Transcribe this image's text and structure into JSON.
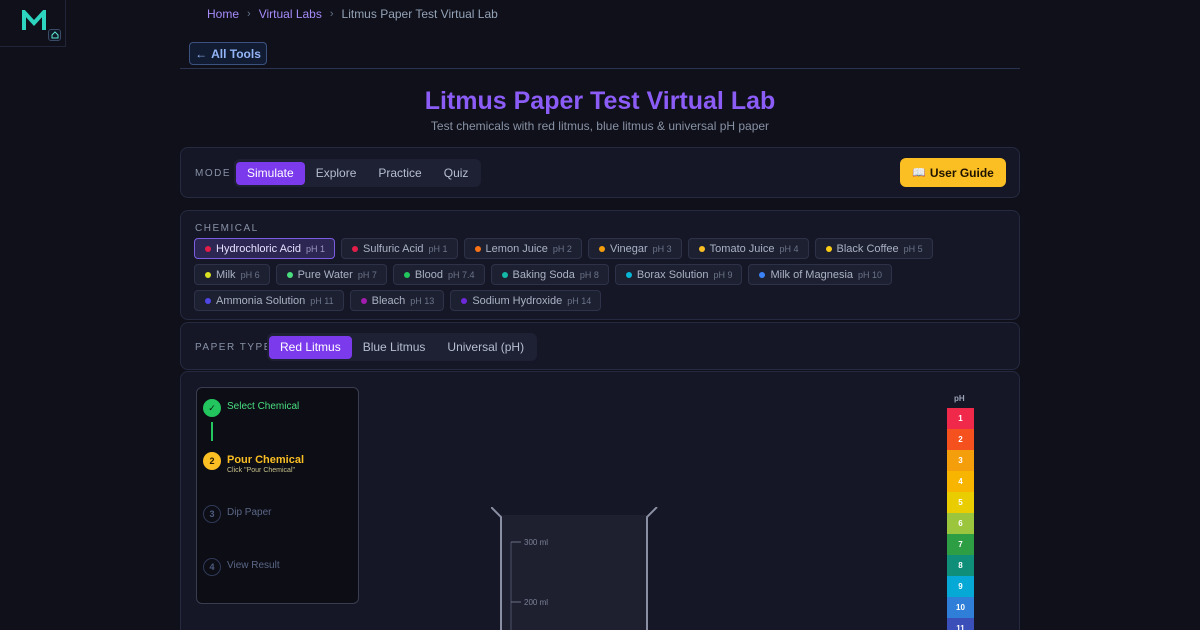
{
  "logo": {
    "letter": "M",
    "icon": "home-icon"
  },
  "breadcrumb": {
    "items": [
      "Home",
      "Virtual Labs"
    ],
    "current": "Litmus Paper Test Virtual Lab",
    "separator": "›"
  },
  "back_button": {
    "label": "All Tools",
    "icon": "arrow-left-icon"
  },
  "header": {
    "title": "Litmus Paper Test Virtual Lab",
    "subtitle": "Test chemicals with red litmus, blue litmus & universal pH paper"
  },
  "mode": {
    "label": "MODE",
    "options": [
      "Simulate",
      "Explore",
      "Practice",
      "Quiz"
    ],
    "selected": "Simulate"
  },
  "user_guide": {
    "label": "User Guide",
    "icon": "📖"
  },
  "chemical": {
    "label": "CHEMICAL",
    "selected": "Hydrochloric Acid",
    "items": [
      {
        "name": "Hydrochloric Acid",
        "ph": "pH 1",
        "color": "#e11d48"
      },
      {
        "name": "Sulfuric Acid",
        "ph": "pH 1",
        "color": "#e11d48"
      },
      {
        "name": "Lemon Juice",
        "ph": "pH 2",
        "color": "#f97316"
      },
      {
        "name": "Vinegar",
        "ph": "pH 3",
        "color": "#f59e0b"
      },
      {
        "name": "Tomato Juice",
        "ph": "pH 4",
        "color": "#fbbf24"
      },
      {
        "name": "Black Coffee",
        "ph": "pH 5",
        "color": "#facc15"
      },
      {
        "name": "Milk",
        "ph": "pH 6",
        "color": "#d9e021"
      },
      {
        "name": "Pure Water",
        "ph": "pH 7",
        "color": "#4ade80"
      },
      {
        "name": "Blood",
        "ph": "pH 7.4",
        "color": "#22c55e"
      },
      {
        "name": "Baking Soda",
        "ph": "pH 8",
        "color": "#14b8a6"
      },
      {
        "name": "Borax Solution",
        "ph": "pH 9",
        "color": "#06b6d4"
      },
      {
        "name": "Milk of Magnesia",
        "ph": "pH 10",
        "color": "#3b82f6"
      },
      {
        "name": "Ammonia Solution",
        "ph": "pH 11",
        "color": "#4f46e5"
      },
      {
        "name": "Bleach",
        "ph": "pH 13",
        "color": "#a21caf"
      },
      {
        "name": "Sodium Hydroxide",
        "ph": "pH 14",
        "color": "#6d28d9"
      }
    ]
  },
  "paper_type": {
    "label": "PAPER TYPE",
    "options": [
      "Red Litmus",
      "Blue Litmus",
      "Universal (pH)"
    ],
    "selected": "Red Litmus"
  },
  "steps": [
    {
      "num": "1",
      "label": "Select Chemical",
      "state": "done",
      "icon": "check-icon"
    },
    {
      "num": "2",
      "label": "Pour Chemical",
      "hint": "Click \"Pour Chemical\"",
      "state": "current"
    },
    {
      "num": "3",
      "label": "Dip Paper",
      "state": "todo"
    },
    {
      "num": "4",
      "label": "View Result",
      "state": "todo"
    }
  ],
  "beaker": {
    "marks": [
      "300 ml",
      "200 ml"
    ]
  },
  "ph_scale": {
    "title": "pH",
    "levels": [
      {
        "value": "1",
        "color": "#f0284a"
      },
      {
        "value": "2",
        "color": "#f4511e"
      },
      {
        "value": "3",
        "color": "#f59e0b"
      },
      {
        "value": "4",
        "color": "#f7b500"
      },
      {
        "value": "5",
        "color": "#eacd00"
      },
      {
        "value": "6",
        "color": "#9bc53d"
      },
      {
        "value": "7",
        "color": "#2e9e45"
      },
      {
        "value": "8",
        "color": "#0f8f7a"
      },
      {
        "value": "9",
        "color": "#06a9d6"
      },
      {
        "value": "10",
        "color": "#2f7fd8"
      },
      {
        "value": "11",
        "color": "#3a4fb8"
      }
    ]
  }
}
